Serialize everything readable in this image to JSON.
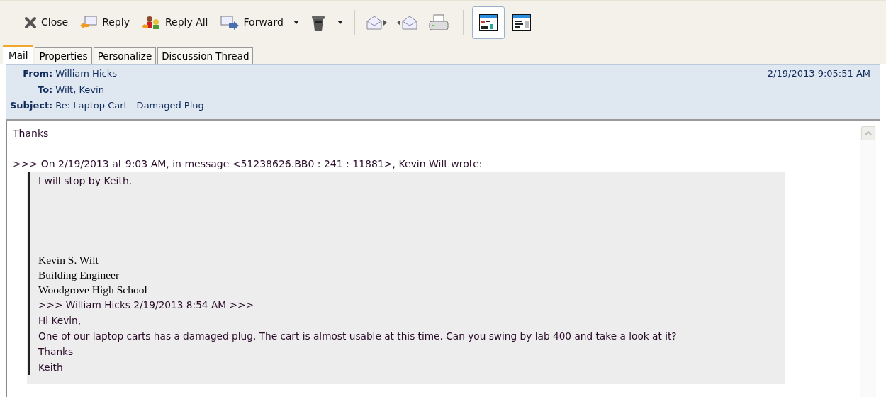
{
  "toolbar": {
    "actions": [
      {
        "label": "Close"
      },
      {
        "label": "Reply"
      },
      {
        "label": "Reply All"
      },
      {
        "label": "Forward"
      }
    ],
    "view_toggles": [
      {
        "selected": true
      },
      {
        "selected": false
      }
    ]
  },
  "tabs": [
    {
      "label": "Mail",
      "selected": true
    },
    {
      "label": "Properties",
      "selected": false
    },
    {
      "label": "Personalize",
      "selected": false
    },
    {
      "label": "Discussion Thread",
      "selected": false
    }
  ],
  "header": {
    "fields": [
      {
        "label": "From:",
        "value": "William Hicks"
      },
      {
        "label": "To:",
        "value": "Wilt, Kevin"
      },
      {
        "label": "Subject:",
        "value": "Re: Laptop Cart - Damaged Plug"
      }
    ],
    "date": "2/19/2013 9:05:51 AM"
  },
  "body": {
    "reply": "Thanks",
    "attribution": ">>> On 2/19/2013 at 9:03 AM, in message <51238626.BB0 : 241 : 11881>, Kevin Wilt wrote:",
    "quote": {
      "message": "I will stop by Keith.",
      "signature": [
        "Kevin S. Wilt",
        "Building Engineer",
        "Woodgrove High School"
      ],
      "forwarded": [
        ">>> William Hicks 2/19/2013 8:54 AM >>>",
        "Hi Kevin,",
        "One of our laptop carts has a damaged plug. The cart is almost usable at this time. Can you swing by lab 400 and take a look at it?",
        "Thanks",
        "Keith"
      ]
    }
  }
}
